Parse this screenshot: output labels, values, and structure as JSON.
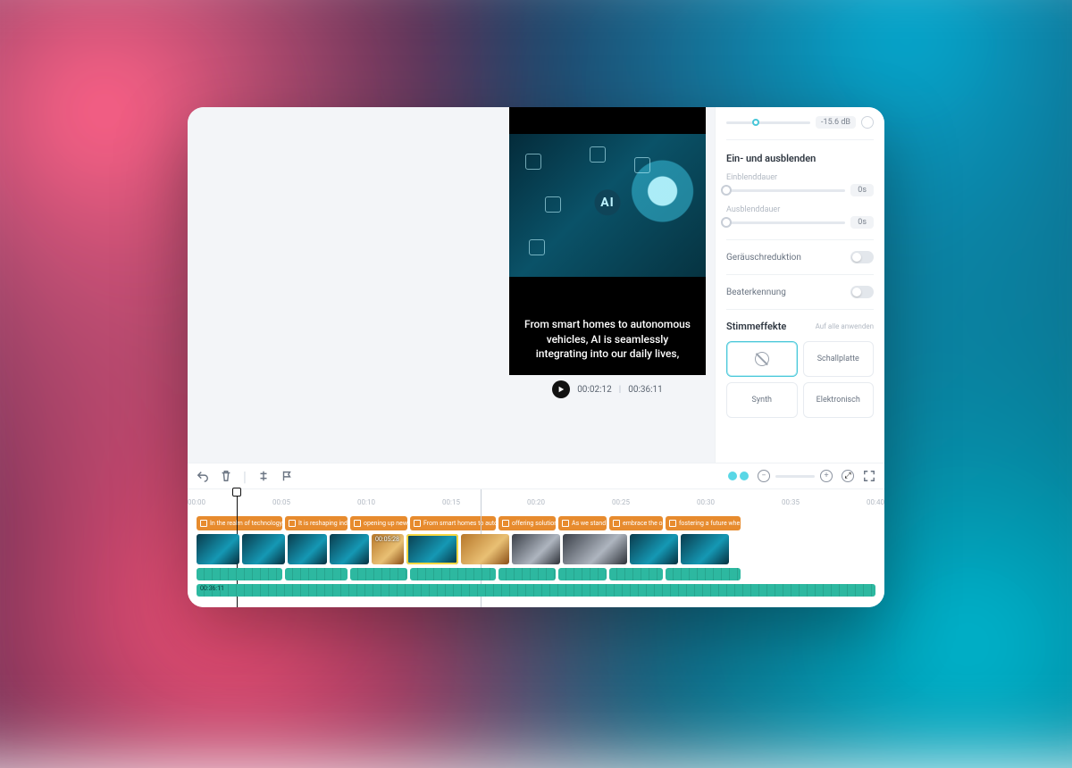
{
  "preview": {
    "subtitle": "From smart homes to autonomous vehicles, AI is seamlessly integrating into our daily lives,",
    "current_time": "00:02:12",
    "total_time": "00:36:11"
  },
  "side_panel": {
    "volume_db": "-15.6 dB",
    "fade_section": "Ein- und ausblenden",
    "fade_in_label": "Einblenddauer",
    "fade_in_value": "0s",
    "fade_out_label": "Ausblenddauer",
    "fade_out_value": "0s",
    "noise_label": "Geräuschreduktion",
    "beat_label": "Beaterkennung",
    "voice_fx_label": "Stimmeffekte",
    "apply_all": "Auf alle anwenden",
    "fx": {
      "none": "",
      "schallplatte": "Schallplatte",
      "synth": "Synth",
      "elektronisch": "Elektronisch"
    }
  },
  "ruler": [
    "00:00",
    "00:05",
    "00:10",
    "00:15",
    "00:20",
    "00:25",
    "00:30",
    "00:35",
    "00:40"
  ],
  "subtitle_clips": [
    "In the realm of technology, t",
    "It is reshaping indus",
    "opening up new p",
    "From smart homes to auton",
    "offering solutions",
    "As we stand o",
    "embrace the opp",
    "fostering a future whe"
  ],
  "video_clips": [
    {
      "w": 48,
      "style": ""
    },
    {
      "w": 48,
      "style": ""
    },
    {
      "w": 44,
      "style": ""
    },
    {
      "w": 44,
      "style": ""
    },
    {
      "w": 36,
      "style": "alt",
      "tc": "00:05:28"
    },
    {
      "w": 58,
      "style": "sel"
    },
    {
      "w": 54,
      "style": "alt"
    },
    {
      "w": 54,
      "style": "gr"
    },
    {
      "w": 72,
      "style": "gr"
    },
    {
      "w": 54,
      "style": ""
    },
    {
      "w": 54,
      "style": ""
    }
  ],
  "audio2_tc": "00:36:11",
  "playhead_pct": 7,
  "marker_pct": 42,
  "subtitle_widths": [
    96,
    70,
    64,
    96,
    64,
    54,
    60,
    84
  ],
  "audio1_widths": [
    96,
    70,
    64,
    96,
    64,
    54,
    60,
    84
  ]
}
